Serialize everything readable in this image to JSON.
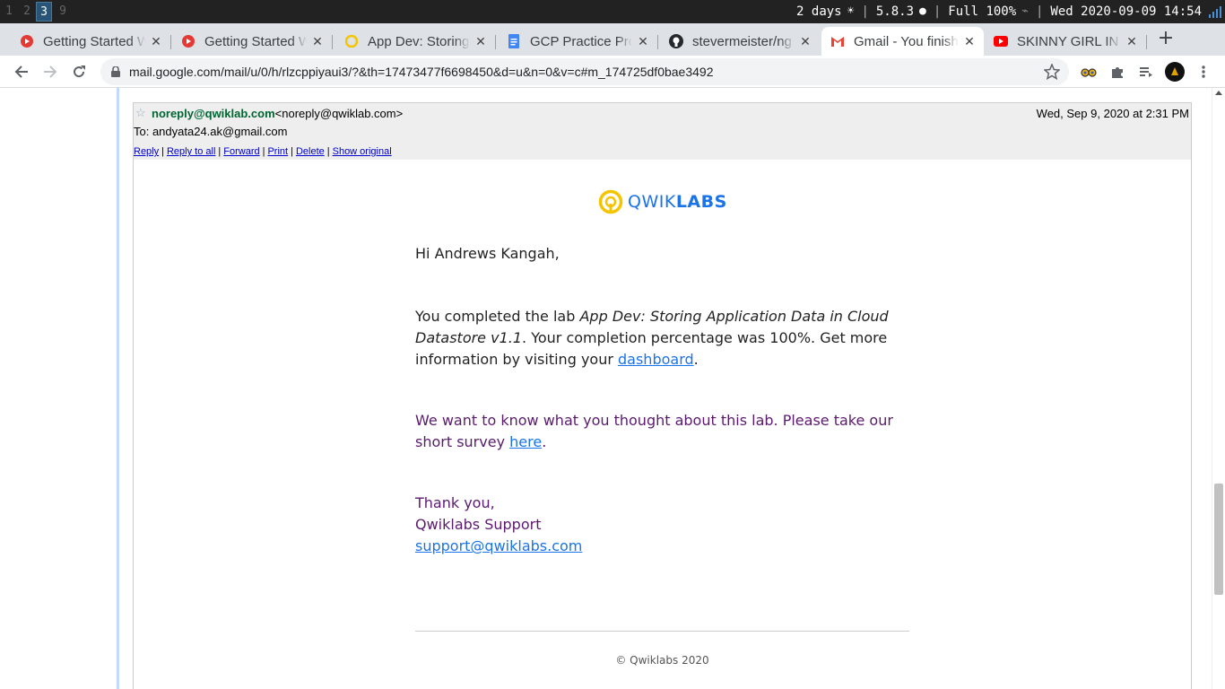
{
  "statusbar": {
    "workspaces": [
      "1",
      "2",
      "3",
      "9"
    ],
    "active_workspace": "3",
    "uptime": "2 days",
    "kernel": "5.8.3",
    "battery": "Full 100%",
    "datetime": "Wed 2020-09-09 14:54"
  },
  "tabs": [
    {
      "title": "Getting Started W",
      "icon": "youtube-circle-icon"
    },
    {
      "title": "Getting Started W",
      "icon": "youtube-circle-icon"
    },
    {
      "title": "App Dev: Storing",
      "icon": "qwiklabs-icon"
    },
    {
      "title": "GCP Practice Proj",
      "icon": "google-docs-icon"
    },
    {
      "title": "stevermeister/ng",
      "icon": "github-icon"
    },
    {
      "title": "Gmail - You finish",
      "icon": "gmail-icon",
      "active": true
    },
    {
      "title": "SKINNY GIRL IN T",
      "icon": "youtube-icon"
    }
  ],
  "toolbar": {
    "url": "mail.google.com/mail/u/0/h/rlzcppiyaui3/?&th=17473477f6698450&d=u&n=0&v=c#m_174725df0bae3492"
  },
  "email": {
    "from_name": "noreply@qwiklab.com",
    "from_addr": "<noreply@qwiklab.com>",
    "date": "Wed, Sep 9, 2020 at 2:31 PM",
    "to": "To: andyata24.ak@gmail.com",
    "actions": [
      "Reply",
      "Reply to all",
      "Forward",
      "Print",
      "Delete",
      "Show original"
    ],
    "logo_light": "QWIK",
    "logo_bold": "LABS",
    "greeting": "Hi Andrews Kangah,",
    "p1_a": "You completed the lab ",
    "p1_lab": "App Dev: Storing Application Data in Cloud Datastore v1.1",
    "p1_b": ". Your completion percentage was 100%. Get more information by visiting your ",
    "p1_link": "dashboard",
    "p1_end": ".",
    "p2_a": "We want to know what you thought about this lab. Please take our short survey ",
    "p2_link": "here",
    "p2_end": ".",
    "sign_thanks": "Thank you,",
    "sign_team": "Qwiklabs Support",
    "sign_email": "support@qwiklabs.com",
    "footer": "© Qwiklabs 2020"
  }
}
